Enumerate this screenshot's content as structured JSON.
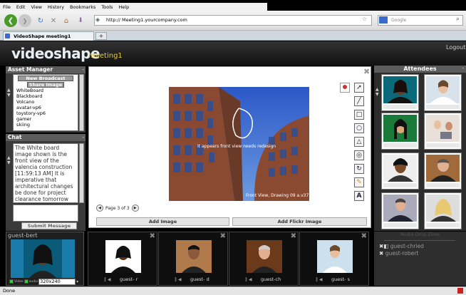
{
  "browser": {
    "menus": [
      "File",
      "Edit",
      "View",
      "History",
      "Bookmarks",
      "Tools",
      "Help"
    ],
    "url": "http:// Meeting1.yourcompany.com",
    "search_placeholder": "Google",
    "tab_title": "VideoShape meeting1",
    "status": "Done"
  },
  "app": {
    "logo": "videoshape",
    "meeting_name": "meeting1",
    "logout": "Logout"
  },
  "asset_manager": {
    "title": "Asset Manager",
    "new_broadcast": "New Broadcast",
    "share_image": "Share Image",
    "items": [
      "WhiteBoard",
      "Blackboard",
      "Volcano",
      "avatar-vp6",
      "toystory-vp6",
      "gamer",
      "skiing"
    ]
  },
  "chat": {
    "title": "Chat",
    "message": "The White board image shown is the front view of the valencia construction [11:59:13 AM] It is imperative that architectural changes be done for project clearance tomorrow",
    "submit": "Submit Message"
  },
  "whiteboard": {
    "annotation": "It appears front view needs redesign",
    "caption": "Front View, Drawing 09 a.v37",
    "page_label": "Page 3 of 3",
    "add_image": "Add Image",
    "add_flickr": "Add Flickr Image",
    "tools": [
      "pointer-tool",
      "line-tool",
      "rectangle-tool",
      "circle-tool",
      "triangle-tool",
      "ring-tool",
      "rotate-tool",
      "pencil-tool",
      "text-tool"
    ]
  },
  "attendees": {
    "title": "Attendees"
  },
  "local_video": {
    "name": "guest-bert",
    "video_label": "Video",
    "audio_label": "audio",
    "resolution": "320x240"
  },
  "videos": [
    {
      "label": "guest- r"
    },
    {
      "label": "guest- d"
    },
    {
      "label": "guest-ch"
    },
    {
      "label": "guest- s"
    }
  ],
  "drop_zone": {
    "title": "Audio Drop Zone",
    "guests": [
      "guest-chried",
      "guest-robert"
    ]
  },
  "colors": {
    "accent": "#e2c84a",
    "panel": "#3a3a3a",
    "header": "#5c5c5c"
  }
}
